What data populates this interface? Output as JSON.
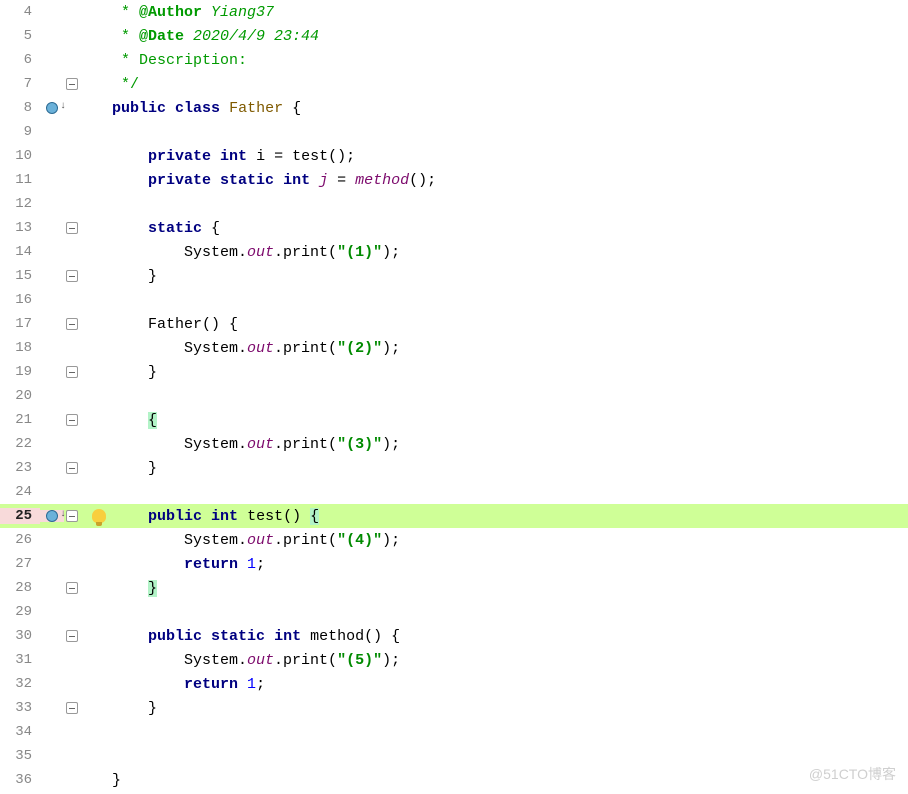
{
  "editor": {
    "lines": [
      {
        "n": 4,
        "fold": "line",
        "code": [
          " * ",
          [
            "@Author",
            "doc-green"
          ],
          [
            " Yiang37",
            "doc-link"
          ]
        ]
      },
      {
        "n": 5,
        "fold": "line",
        "code": [
          " * ",
          [
            "@Date",
            "doc-green"
          ],
          [
            " 2020/4/9 23:44",
            "doc-link"
          ]
        ]
      },
      {
        "n": 6,
        "fold": "line",
        "code": [
          [
            " * Description:",
            "doc-green2"
          ]
        ]
      },
      {
        "n": 7,
        "fold": "close",
        "code": [
          [
            " */",
            "doc-star"
          ]
        ]
      },
      {
        "n": 8,
        "mark": "override",
        "fold": "line",
        "code": [
          [
            "public",
            "keyword"
          ],
          [
            " ",
            "ident"
          ],
          [
            "class",
            "keyword"
          ],
          [
            " ",
            "ident"
          ],
          [
            "Father",
            "cls"
          ],
          [
            " {",
            "brace"
          ]
        ]
      },
      {
        "n": 9,
        "fold": "line",
        "code": []
      },
      {
        "n": 10,
        "fold": "line",
        "code": [
          [
            "    ",
            "ident"
          ],
          [
            "private",
            "keyword"
          ],
          [
            " ",
            "ident"
          ],
          [
            "int",
            "type"
          ],
          [
            " i = test();",
            "ident"
          ]
        ]
      },
      {
        "n": 11,
        "fold": "line",
        "code": [
          [
            "    ",
            "ident"
          ],
          [
            "private",
            "keyword"
          ],
          [
            " ",
            "ident"
          ],
          [
            "static",
            "keyword"
          ],
          [
            " ",
            "ident"
          ],
          [
            "int",
            "type"
          ],
          [
            " ",
            "ident"
          ],
          [
            "j",
            "static-f"
          ],
          [
            " = ",
            "ident"
          ],
          [
            "method",
            "static-f"
          ],
          [
            "();",
            "ident"
          ]
        ]
      },
      {
        "n": 12,
        "fold": "line",
        "code": []
      },
      {
        "n": 13,
        "fold": "open",
        "code": [
          [
            "    ",
            "ident"
          ],
          [
            "static",
            "keyword"
          ],
          [
            " {",
            "brace"
          ]
        ]
      },
      {
        "n": 14,
        "fold": "line",
        "code": [
          [
            "        System.",
            "ident"
          ],
          [
            "out",
            "static-f"
          ],
          [
            ".print(",
            "ident"
          ],
          [
            "\"(1)\"",
            "str"
          ],
          [
            ");",
            "ident"
          ]
        ]
      },
      {
        "n": 15,
        "fold": "close",
        "code": [
          [
            "    }",
            "brace"
          ]
        ]
      },
      {
        "n": 16,
        "fold": "line",
        "code": []
      },
      {
        "n": 17,
        "fold": "open",
        "code": [
          [
            "    Father() {",
            "ident"
          ]
        ]
      },
      {
        "n": 18,
        "fold": "line",
        "code": [
          [
            "        System.",
            "ident"
          ],
          [
            "out",
            "static-f"
          ],
          [
            ".print(",
            "ident"
          ],
          [
            "\"(2)\"",
            "str"
          ],
          [
            ");",
            "ident"
          ]
        ]
      },
      {
        "n": 19,
        "fold": "close",
        "code": [
          [
            "    }",
            "brace"
          ]
        ]
      },
      {
        "n": 20,
        "fold": "line",
        "code": []
      },
      {
        "n": 21,
        "fold": "open",
        "code": [
          [
            "    ",
            "ident"
          ],
          [
            "{",
            "brace",
            "hl-brace"
          ]
        ]
      },
      {
        "n": 22,
        "fold": "line",
        "code": [
          [
            "        System.",
            "ident"
          ],
          [
            "out",
            "static-f"
          ],
          [
            ".print(",
            "ident"
          ],
          [
            "\"(3)\"",
            "str"
          ],
          [
            ");",
            "ident"
          ]
        ]
      },
      {
        "n": 23,
        "fold": "close",
        "code": [
          [
            "    }",
            "brace"
          ]
        ]
      },
      {
        "n": 24,
        "fold": "line",
        "code": []
      },
      {
        "n": 25,
        "mark": "override",
        "fold": "open",
        "bulb": true,
        "hl": true,
        "cur": true,
        "code": [
          [
            "    ",
            "ident"
          ],
          [
            "public",
            "keyword"
          ],
          [
            " ",
            "ident"
          ],
          [
            "int",
            "type"
          ],
          [
            " test() ",
            "ident"
          ],
          [
            "{",
            "brace",
            "hl-brace"
          ]
        ]
      },
      {
        "n": 26,
        "fold": "line",
        "code": [
          [
            "        System.",
            "ident"
          ],
          [
            "out",
            "static-f"
          ],
          [
            ".print(",
            "ident"
          ],
          [
            "\"(4)\"",
            "str"
          ],
          [
            ");",
            "ident"
          ]
        ]
      },
      {
        "n": 27,
        "fold": "line",
        "code": [
          [
            "        ",
            "ident"
          ],
          [
            "return",
            "keyword"
          ],
          [
            " ",
            "ident"
          ],
          [
            "1",
            "num"
          ],
          [
            ";",
            "ident"
          ]
        ]
      },
      {
        "n": 28,
        "fold": "close",
        "code": [
          [
            "    ",
            "ident"
          ],
          [
            "}",
            "brace",
            "hl-brace"
          ]
        ]
      },
      {
        "n": 29,
        "fold": "line",
        "code": []
      },
      {
        "n": 30,
        "fold": "open",
        "code": [
          [
            "    ",
            "ident"
          ],
          [
            "public",
            "keyword"
          ],
          [
            " ",
            "ident"
          ],
          [
            "static",
            "keyword"
          ],
          [
            " ",
            "ident"
          ],
          [
            "int",
            "type"
          ],
          [
            " method() {",
            "ident"
          ]
        ]
      },
      {
        "n": 31,
        "fold": "line",
        "code": [
          [
            "        System.",
            "ident"
          ],
          [
            "out",
            "static-f"
          ],
          [
            ".print(",
            "ident"
          ],
          [
            "\"(5)\"",
            "str"
          ],
          [
            ");",
            "ident"
          ]
        ]
      },
      {
        "n": 32,
        "fold": "line",
        "code": [
          [
            "        ",
            "ident"
          ],
          [
            "return",
            "keyword"
          ],
          [
            " ",
            "ident"
          ],
          [
            "1",
            "num"
          ],
          [
            ";",
            "ident"
          ]
        ]
      },
      {
        "n": 33,
        "fold": "close",
        "code": [
          [
            "    }",
            "brace"
          ]
        ]
      },
      {
        "n": 34,
        "fold": "line",
        "code": []
      },
      {
        "n": 35,
        "fold": "line",
        "code": []
      },
      {
        "n": 36,
        "fold": "line",
        "code": [
          [
            "}",
            "brace"
          ]
        ]
      }
    ]
  },
  "watermark": "@51CTO博客"
}
